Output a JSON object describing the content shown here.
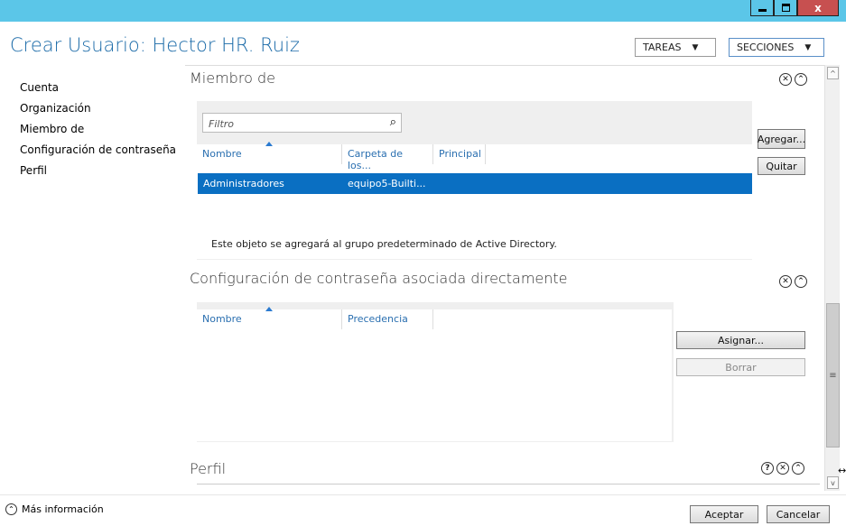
{
  "window": {
    "minimize_label": "",
    "maximize_label": "",
    "close_label": "x"
  },
  "header": {
    "title": "Crear Usuario: Hector HR. Ruiz",
    "tasks_label": "TAREAS",
    "sections_label": "SECCIONES"
  },
  "sidebar": {
    "items": [
      {
        "label": "Cuenta"
      },
      {
        "label": "Organización"
      },
      {
        "label": "Miembro de"
      },
      {
        "label": "Configuración de contraseña"
      },
      {
        "label": "Perfil"
      }
    ]
  },
  "member_of": {
    "title": "Miembro de",
    "filter_placeholder": "Filtro",
    "columns": [
      "Nombre",
      "Carpeta de los...",
      "Principal"
    ],
    "rows": [
      {
        "name": "Administradores",
        "folder": "equipo5-Builti...",
        "primary": ""
      }
    ],
    "add_label": "Agregar...",
    "remove_label": "Quitar",
    "info_text": "Este objeto se agregará al grupo predeterminado de Active Directory."
  },
  "password_settings": {
    "title": "Configuración de contraseña asociada directamente",
    "columns": [
      "Nombre",
      "Precedencia"
    ],
    "assign_label": "Asignar...",
    "clear_label": "Borrar"
  },
  "profile": {
    "title": "Perfil",
    "help_glyph": "?"
  },
  "footer": {
    "more_info_label": "Más información",
    "ok_label": "Aceptar",
    "cancel_label": "Cancelar"
  },
  "glyphs": {
    "close": "✕",
    "collapse": "⌃",
    "expand_more": "⌃",
    "search": "⌕",
    "dropdown": "▼",
    "scroll_up": "^",
    "scroll_down": "v",
    "grip": "≡",
    "resize": "↔"
  },
  "colors": {
    "titlebar": "#5bc6e8",
    "title_text": "#1a6aa8",
    "selection": "#0a6fc2",
    "column_header_text": "#2a6fb0"
  }
}
